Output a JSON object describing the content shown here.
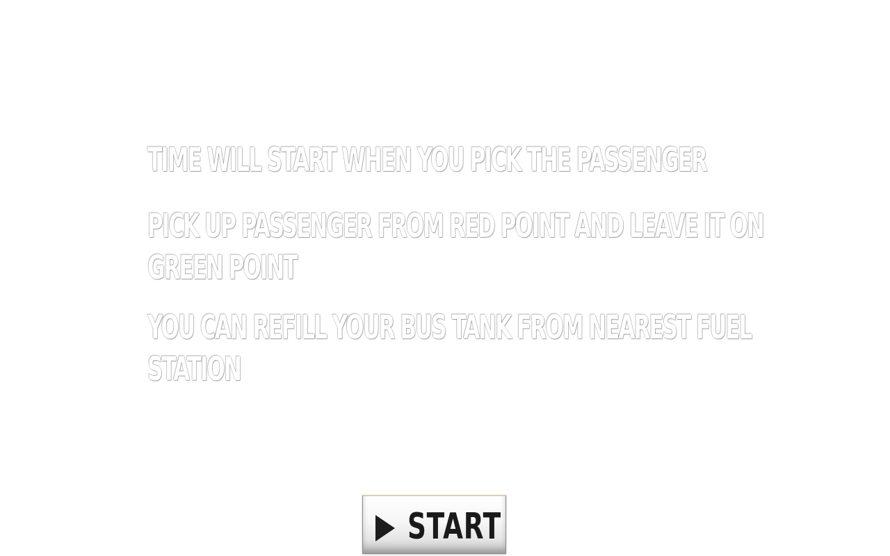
{
  "instructions": [
    "TIME WILL START WHEN YOU PICK THE PASSENGER",
    "PICK UP PASSENGER FROM RED POINT AND LEAVE IT ON GREEN POINT",
    "YOU CAN REFILL YOUR BUS TANK FROM NEAREST FUEL STATION"
  ],
  "start_button": {
    "label": "START",
    "icon": "play-icon"
  },
  "colors": {
    "background": "#ffffff",
    "instruction_text": "#ffffff",
    "button_text": "#1a1a1a"
  }
}
